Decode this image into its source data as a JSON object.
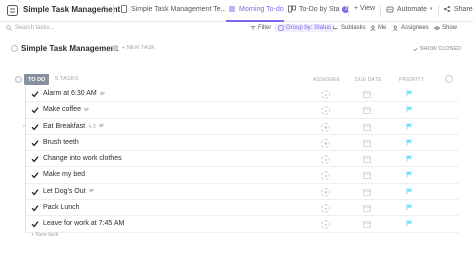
{
  "workspace": {
    "title": "Simple Task Management",
    "caret": "•"
  },
  "tabs": [
    {
      "label": "Simple Task Management Te...",
      "active": false,
      "icon": "doc-icon"
    },
    {
      "label": "Morning To-do",
      "active": true,
      "icon": "list-icon"
    },
    {
      "label": "To-Do by Sta",
      "active": false,
      "icon": "board-icon",
      "badge": "3"
    }
  ],
  "top_actions": {
    "view_label": "+ View",
    "automate_label": "Automate",
    "share_label": "Share"
  },
  "filterbar": {
    "search_placeholder": "Search tasks...",
    "filter_label": "Filter",
    "group_by_label": "Group by: Status",
    "subtasks_label": "Subtasks",
    "me_label": "Me",
    "assignees_label": "Assignees",
    "show_label": "Show"
  },
  "page": {
    "title": "Simple Task Management",
    "new_task_label": "+ NEW TASK",
    "show_closed_label": "SHOW CLOSED"
  },
  "group": {
    "status_label": "TO DO",
    "count_label": "9 TASKS",
    "columns": {
      "assignee": "ASSIGNEE",
      "due_date": "DUE DATE",
      "priority": "PRIORITY"
    }
  },
  "tasks": [
    {
      "name": "Alarm at 6:30 AM",
      "subtasks": "",
      "has_tag": true,
      "expandable": false
    },
    {
      "name": "Make coffee",
      "subtasks": "",
      "has_tag": true,
      "expandable": false
    },
    {
      "name": "Eat Breakfast",
      "subtasks": "3",
      "has_tag": true,
      "expandable": true
    },
    {
      "name": "Brush teeth",
      "subtasks": "",
      "has_tag": false,
      "expandable": false
    },
    {
      "name": "Change into work clothes",
      "subtasks": "",
      "has_tag": false,
      "expandable": false
    },
    {
      "name": "Make my bed",
      "subtasks": "",
      "has_tag": false,
      "expandable": false
    },
    {
      "name": "Let Dog's Out",
      "subtasks": "",
      "has_tag": true,
      "expandable": false
    },
    {
      "name": "Pack Lunch",
      "subtasks": "",
      "has_tag": false,
      "expandable": false
    },
    {
      "name": "Leave for work at 7:45 AM",
      "subtasks": "",
      "has_tag": false,
      "expandable": false
    }
  ],
  "footer": {
    "new_task_label": "+ New task"
  },
  "colors": {
    "accent": "#7b68ee",
    "status_todo": "#87909e",
    "priority_flag": "#6fddff",
    "check": "#1e1e1e"
  }
}
